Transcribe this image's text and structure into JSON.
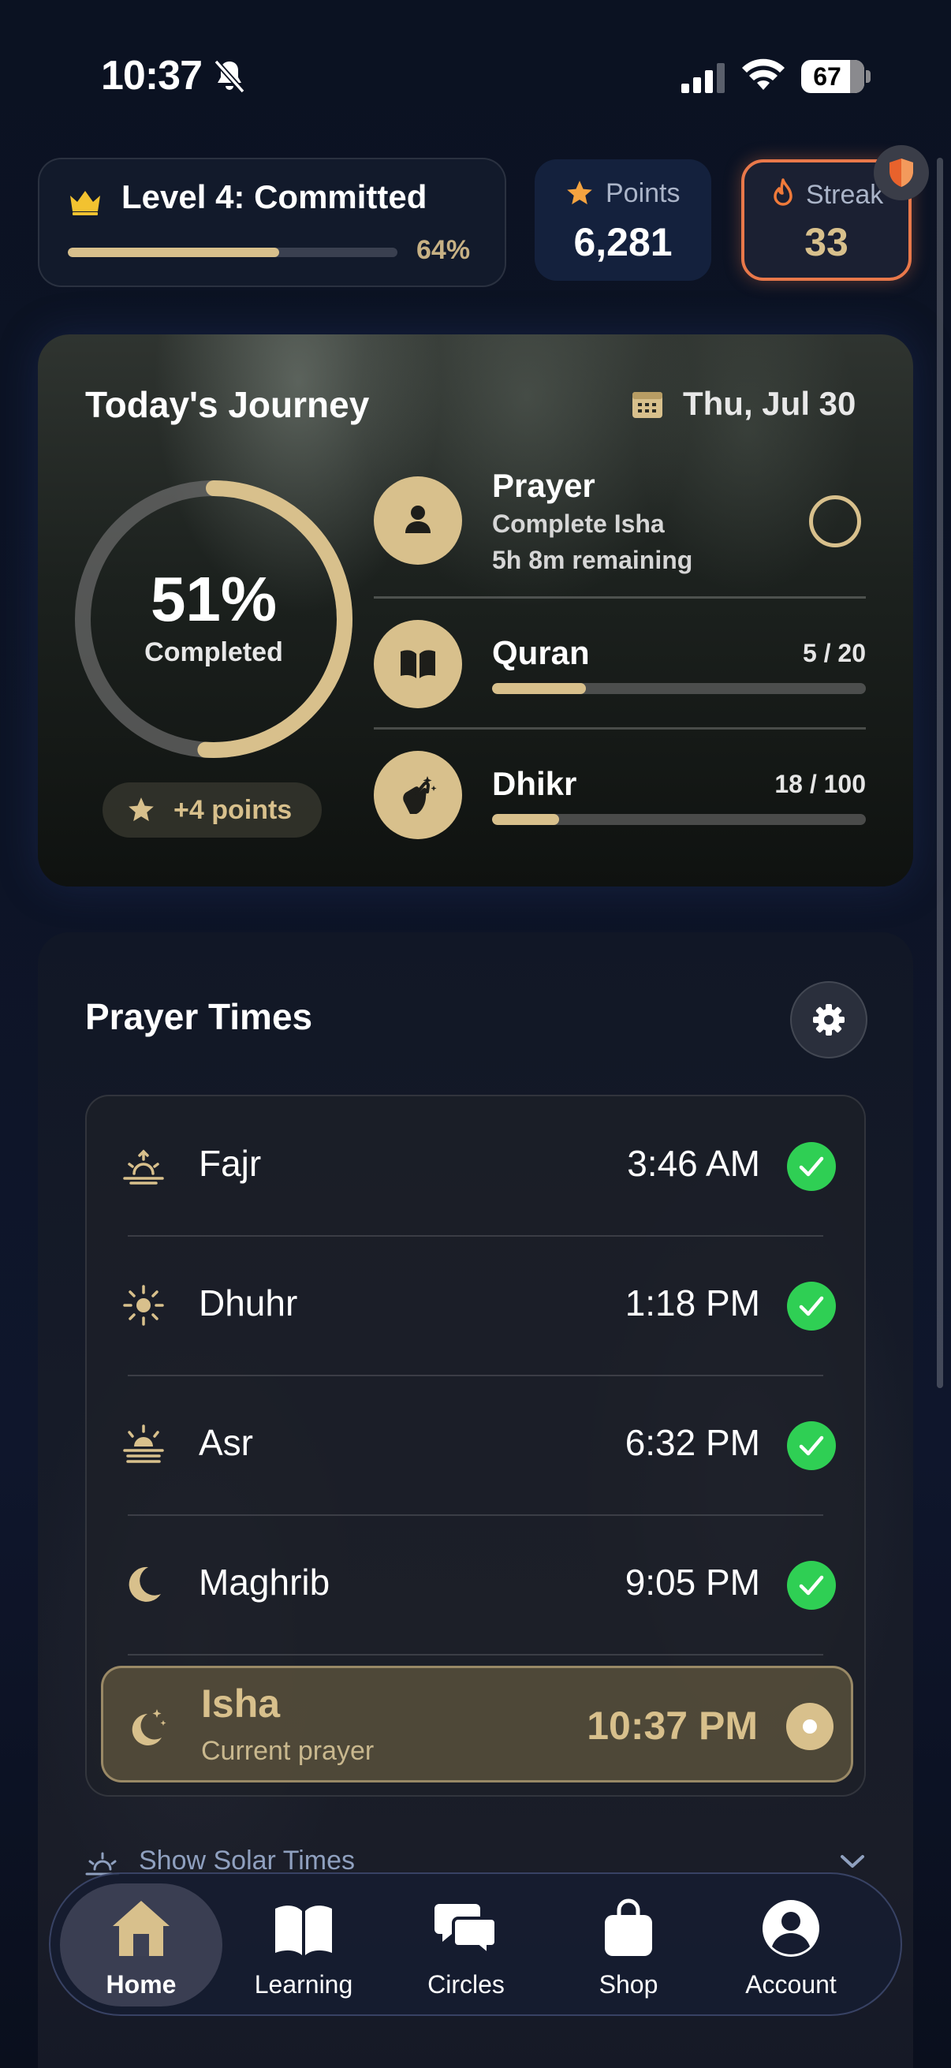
{
  "status_bar": {
    "time": "10:37",
    "battery": "67"
  },
  "level": {
    "title": "Level 4: Committed",
    "progress_label": "64%",
    "progress": 0.64
  },
  "points": {
    "label": "Points",
    "value": "6,281"
  },
  "streak": {
    "label": "Streak",
    "value": "33"
  },
  "journey": {
    "title": "Today's Journey",
    "date": "Thu, Jul 30",
    "completion_percent": "51%",
    "completion_value": 0.51,
    "completion_label": "Completed",
    "points_badge": "+4 points",
    "tasks": {
      "prayer": {
        "title": "Prayer",
        "subtitle": "Complete Isha",
        "remaining": "5h 8m remaining"
      },
      "quran": {
        "title": "Quran",
        "count": "5 / 20",
        "progress": 0.25
      },
      "dhikr": {
        "title": "Dhikr",
        "count": "18 / 100",
        "progress": 0.18
      }
    }
  },
  "prayer_times": {
    "title": "Prayer Times",
    "rows": [
      {
        "name": "Fajr",
        "time": "3:46 AM",
        "icon": "sunrise-icon",
        "done": true
      },
      {
        "name": "Dhuhr",
        "time": "1:18 PM",
        "icon": "sun-icon",
        "done": true
      },
      {
        "name": "Asr",
        "time": "6:32 PM",
        "icon": "sun-haze-icon",
        "done": true
      },
      {
        "name": "Maghrib",
        "time": "9:05 PM",
        "icon": "moon-icon",
        "done": true
      }
    ],
    "current": {
      "name": "Isha",
      "subtitle": "Current prayer",
      "time": "10:37 PM",
      "icon": "moon-stars-icon"
    },
    "solar_toggle": "Show Solar Times"
  },
  "tab_bar": {
    "tabs": [
      {
        "label": "Home",
        "icon": "home-icon"
      },
      {
        "label": "Learning",
        "icon": "book-icon"
      },
      {
        "label": "Circles",
        "icon": "chat-bubbles-icon"
      },
      {
        "label": "Shop",
        "icon": "shopping-bag-icon"
      },
      {
        "label": "Account",
        "icon": "user-circle-icon"
      }
    ],
    "active": "Home"
  },
  "colors": {
    "accent_gold": "#d8c08c",
    "streak_orange": "#e9784a",
    "success_green": "#2fcf54",
    "background": "#0b1120"
  }
}
